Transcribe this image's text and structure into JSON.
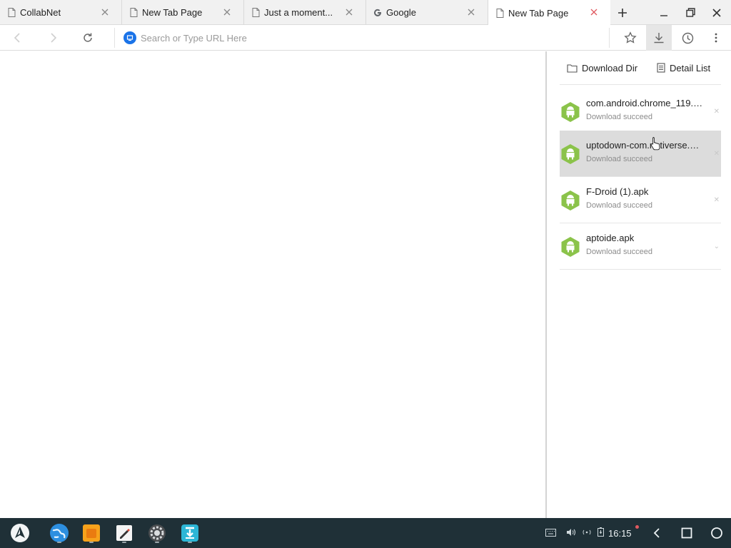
{
  "tabs": [
    {
      "label": "CollabNet",
      "icon": "page-icon"
    },
    {
      "label": "New Tab Page",
      "icon": "page-icon"
    },
    {
      "label": "Just a moment...",
      "icon": "page-icon"
    },
    {
      "label": "Google",
      "icon": "google-icon"
    },
    {
      "label": "New Tab Page",
      "icon": "page-icon",
      "active": true
    }
  ],
  "toolbar": {
    "address_placeholder": "Search or Type URL Here"
  },
  "downloads": {
    "dir_label": "Download Dir",
    "detail_label": "Detail List",
    "items": [
      {
        "name": "com.android.chrome_119.0....",
        "status": "Download succeed"
      },
      {
        "name": "uptodown-com.r...tiverse.br...",
        "status": "Download succeed"
      },
      {
        "name": "F-Droid (1).apk",
        "status": "Download succeed"
      },
      {
        "name": "aptoide.apk",
        "status": "Download succeed"
      }
    ]
  },
  "taskbar": {
    "clock": "16:15",
    "apps": [
      "launcher-icon",
      "browser-icon",
      "files-icon",
      "notes-icon",
      "settings-icon",
      "store-icon"
    ]
  },
  "colors": {
    "accent": "#1a73e8",
    "apk_green": "#8bc34a",
    "taskbar": "#1f3037",
    "close_active": "#e0595f"
  }
}
